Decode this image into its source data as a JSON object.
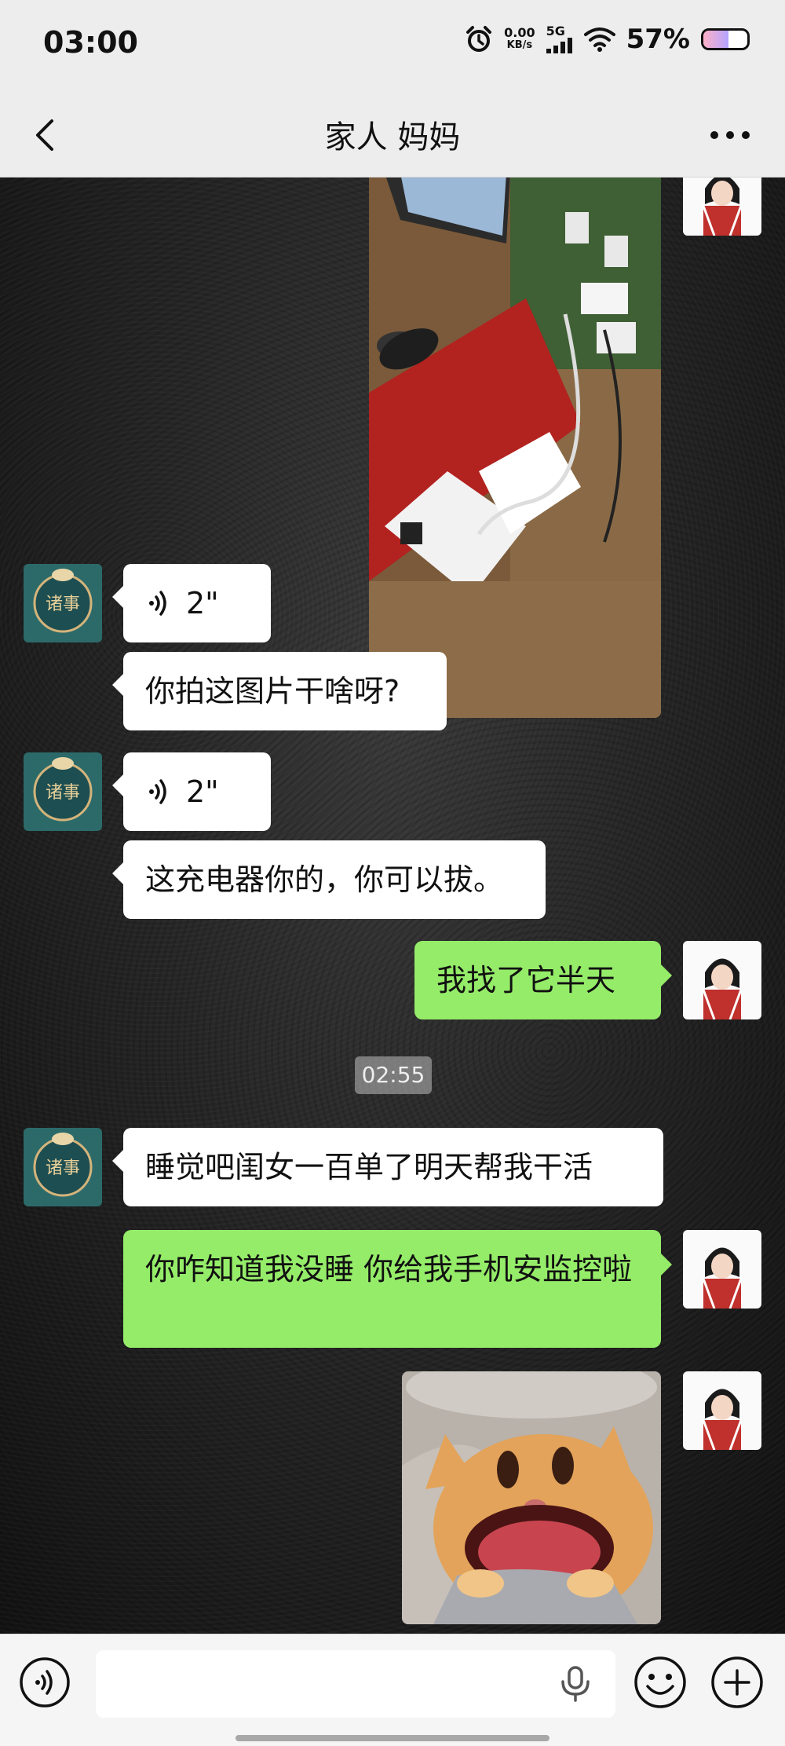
{
  "status_bar": {
    "time": "03:00",
    "net_rate_value": "0.00",
    "net_rate_unit": "KB/s",
    "network": "5G",
    "battery_percent": "57%",
    "battery_level": 0.57
  },
  "header": {
    "title": "家人 妈妈"
  },
  "messages": {
    "m1_voice_duration": "2\"",
    "m2_text": "你拍这图片干啥呀?",
    "m3_voice_duration": "2\"",
    "m4_text": "这充电器你的，你可以拔。",
    "m5_text": "我找了它半天",
    "timestamp": "02:55",
    "m6_text": "睡觉吧闺女一百单了明天帮我干活",
    "m7_text": "你咋知道我没睡 你给我手机安监控啦"
  },
  "input": {
    "placeholder": ""
  },
  "colors": {
    "outgoing_bubble": "#95ec69",
    "incoming_bubble": "#ffffff",
    "header_bg": "#ededed"
  }
}
